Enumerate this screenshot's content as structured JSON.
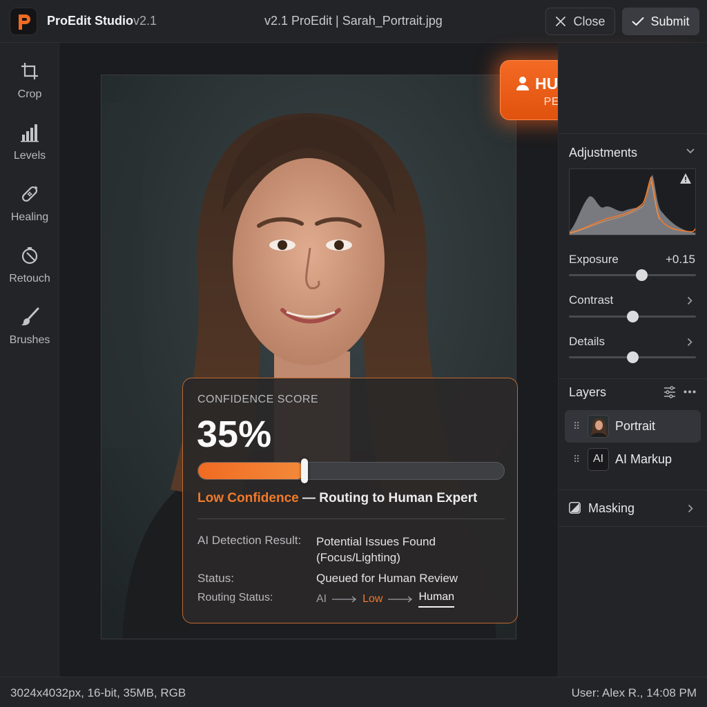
{
  "app": {
    "name": "ProEdit Studio",
    "version": "v2.1",
    "document_title": "v2.1 ProEdit | Sarah_Portrait.jpg"
  },
  "header": {
    "close_label": "Close",
    "submit_label": "Submit"
  },
  "toolbar": {
    "items": [
      {
        "label": "Crop",
        "icon": "crop-icon"
      },
      {
        "label": "Levels",
        "icon": "levels-icon"
      },
      {
        "label": "Healing",
        "icon": "healing-icon"
      },
      {
        "label": "Retouch",
        "icon": "retouch-icon"
      },
      {
        "label": "Brushes",
        "icon": "brush-icon"
      }
    ]
  },
  "review_badge": {
    "title": "HUMAN REVIEW",
    "subtitle": "PENDING REVIEW",
    "icon": "user-icon",
    "color": "#f0661f"
  },
  "confidence": {
    "heading": "CONFIDENCE SCORE",
    "value_text": "35%",
    "value": 0.35,
    "level_label": "Low Confidence",
    "routing_message": "— Routing to Human Expert",
    "accent_color": "#f07a2c",
    "details": [
      {
        "key": "AI Detection Result:",
        "value": "Potential Issues Found (Focus/Lighting)"
      },
      {
        "key": "Status:",
        "value": "Queued for Human Review"
      }
    ],
    "routing": {
      "key": "Routing Status:",
      "steps": [
        "AI",
        "Low",
        "Human"
      ]
    }
  },
  "adjustments": {
    "title": "Adjustments",
    "histogram_warning_icon": "warning-icon",
    "sliders": [
      {
        "label": "Exposure",
        "value_text": "+0.15",
        "level": 0.57
      },
      {
        "label": "Contrast",
        "value_text": "",
        "level": 0.5
      },
      {
        "label": "Details",
        "value_text": "",
        "level": 0.5
      }
    ]
  },
  "layers": {
    "title": "Layers",
    "items": [
      {
        "name": "Portrait",
        "selected": true
      },
      {
        "name": "AI Markup",
        "thumb_text": "AI",
        "selected": false
      }
    ]
  },
  "masking": {
    "label": "Masking"
  },
  "status_bar": {
    "image_info": "3024x4032px, 16-bit, 35MB, RGB",
    "user_time": "User: Alex R., 14:08 PM"
  }
}
